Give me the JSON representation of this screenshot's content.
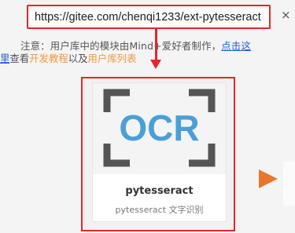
{
  "url_bar": {
    "value": "https://gitee.com/chenqi1233/ext-pytesseract"
  },
  "close_glyph": "×",
  "notice": {
    "line1_prefix": "注意：用户库中的模块由Mind+爱好者制作，",
    "link_part1": "点击这",
    "link_part2": "里",
    "line2_middle1": "查看",
    "dev_tutorial": "开发教程",
    "line2_middle2": "以及",
    "user_library_list": "用户库列表"
  },
  "card": {
    "logo_text": "OCR",
    "title": "pytesseract",
    "description": "pytesseract 文字识别"
  },
  "colors": {
    "highlight_red": "#e3262b",
    "link_blue": "#1c5fd6",
    "accent_orange": "#f19a3a",
    "ocr_blue": "#4a9fd8",
    "bracket_gray": "#555555",
    "arrow_orange": "#e8772e"
  },
  "icons": [
    "close-icon",
    "red-down-arrow-icon",
    "ocr-logo-icon",
    "next-arrow-icon"
  ]
}
